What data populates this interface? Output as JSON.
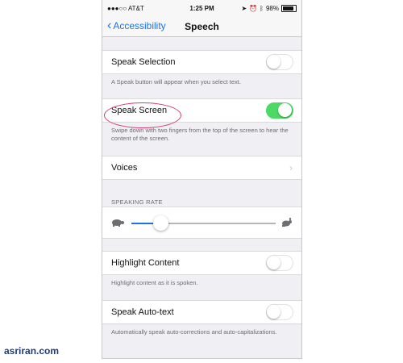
{
  "status": {
    "carrier": "●●●○○ AT&T",
    "time": "1:25 PM",
    "battery": "98%"
  },
  "nav": {
    "back_label": "Accessibility",
    "title": "Speech"
  },
  "settings": {
    "speak_selection": {
      "label": "Speak Selection",
      "on": false,
      "footer": "A Speak button will appear when you select text."
    },
    "speak_screen": {
      "label": "Speak Screen",
      "on": true,
      "footer": "Swipe down with two fingers from the top of the screen to hear the content of the screen."
    },
    "voices": {
      "label": "Voices"
    },
    "speaking_rate": {
      "header": "SPEAKING RATE",
      "value": 0.2
    },
    "highlight_content": {
      "label": "Highlight Content",
      "on": false,
      "footer": "Highlight content as it is spoken."
    },
    "speak_auto_text": {
      "label": "Speak Auto-text",
      "on": false,
      "footer": "Automatically speak auto-corrections and auto-capitalizations."
    }
  },
  "watermark": "asriran.com",
  "colors": {
    "accent": "#1a73e8",
    "toggle_on": "#4cd964",
    "highlight": "#d83a6b"
  },
  "icons": {
    "slow": "turtle-icon",
    "fast": "hare-icon",
    "back": "chevron-left-icon",
    "disclosure": "chevron-right-icon"
  }
}
